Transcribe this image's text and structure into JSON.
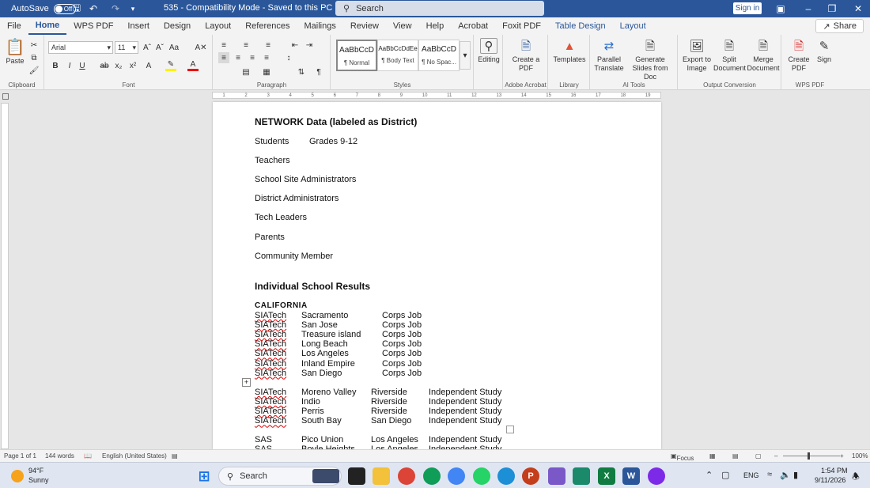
{
  "titlebar": {
    "autosave_label": "AutoSave",
    "autosave_state": "Off",
    "doc_title": "535  -  Compatibility Mode  -  Saved to this PC",
    "search_placeholder": "Search",
    "signin_label": "Sign in"
  },
  "tabs": [
    "File",
    "Home",
    "WPS PDF",
    "Insert",
    "Design",
    "Layout",
    "References",
    "Mailings",
    "Review",
    "View",
    "Help",
    "Acrobat",
    "Foxit PDF",
    "Table Design",
    "Layout"
  ],
  "share_label": "Share",
  "ribbon": {
    "clipboard": {
      "paste": "Paste",
      "label": "Clipboard"
    },
    "font": {
      "name": "Arial",
      "size": "11",
      "label": "Font"
    },
    "paragraph": {
      "label": "Paragraph"
    },
    "styles": {
      "items": [
        {
          "sample": "AaBbCcD",
          "name": "¶ Normal"
        },
        {
          "sample": "AaBbCcDdEe",
          "name": "¶ Body Text"
        },
        {
          "sample": "AaBbCcD",
          "name": "¶ No Spac..."
        }
      ],
      "label": "Styles"
    },
    "editing": {
      "label": "Editing"
    },
    "adobe": {
      "create": "Create a PDF",
      "label": "Adobe Acrobat"
    },
    "library": {
      "templates": "Templates",
      "label": "Library"
    },
    "ai": {
      "parallel": "Parallel Translate",
      "slides": "Generate Slides from Doc",
      "label": "AI Tools"
    },
    "output": {
      "export": "Export to Image",
      "split": "Split Document",
      "merge": "Merge Document",
      "label": "Output Conversion"
    },
    "wps": {
      "create": "Create PDF",
      "sign": "Sign",
      "label": "WPS PDF"
    }
  },
  "ruler": [
    "1",
    "2",
    "3",
    "4",
    "5",
    "6",
    "7",
    "8",
    "9",
    "10",
    "11",
    "12",
    "13",
    "14",
    "15",
    "16",
    "17",
    "18",
    "19"
  ],
  "document": {
    "network_heading": "NETWORK Data (labeled as District)",
    "students": "Students",
    "grades": "Grades 9-12",
    "roles": [
      "Teachers",
      "School Site Administrators",
      "District Administrators",
      "Tech Leaders",
      "Parents",
      "Community Member"
    ],
    "individual_heading": "Individual School Results",
    "state": "CALIFORNIA",
    "table1": [
      [
        "SIATech",
        "Sacramento",
        "Corps Job"
      ],
      [
        "SIATech",
        "San Jose",
        "Corps Job"
      ],
      [
        "SIATech",
        "Treasure island",
        "Corps Job"
      ],
      [
        "SIATech",
        "Long Beach",
        "Corps Job"
      ],
      [
        "SIATech",
        "Los Angeles",
        "Corps Job"
      ],
      [
        "SIATech",
        "Inland Empire",
        "Corps Job"
      ],
      [
        "SIATech",
        "San Diego",
        "Corps Job"
      ]
    ],
    "table2": [
      [
        "SIATech",
        "Moreno Valley",
        "Riverside",
        "Independent Study"
      ],
      [
        "SIATech",
        "Indio",
        "Riverside",
        "Independent Study"
      ],
      [
        "SIATech",
        "Perris",
        "Riverside",
        "Independent Study"
      ],
      [
        "SIATech",
        "South Bay",
        "San Diego",
        "Independent Study"
      ]
    ],
    "table3": [
      [
        "SAS",
        "Pico Union",
        "Los Angeles",
        "Independent Study"
      ],
      [
        "SAS",
        "Boyle Heights",
        "Los Angeles",
        "Independent Study"
      ]
    ]
  },
  "statusbar": {
    "page": "Page 1 of 1",
    "words": "144 words",
    "language": "English (United States)",
    "focus": "Focus",
    "zoom": "100%"
  },
  "taskbar": {
    "weather_temp": "94°F",
    "weather_desc": "Sunny",
    "search": "Search",
    "lang": "ENG",
    "time": "1:54 PM",
    "date": "9/11/2026"
  }
}
